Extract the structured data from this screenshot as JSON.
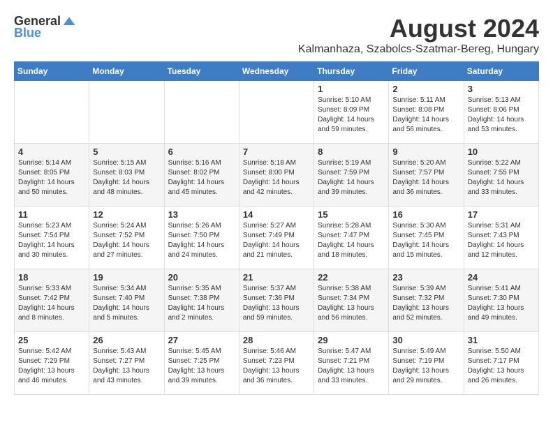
{
  "logo": {
    "general": "General",
    "blue": "Blue"
  },
  "title": "August 2024",
  "location": "Kalmanhaza, Szabolcs-Szatmar-Bereg, Hungary",
  "days_of_week": [
    "Sunday",
    "Monday",
    "Tuesday",
    "Wednesday",
    "Thursday",
    "Friday",
    "Saturday"
  ],
  "weeks": [
    [
      {
        "day": "",
        "info": ""
      },
      {
        "day": "",
        "info": ""
      },
      {
        "day": "",
        "info": ""
      },
      {
        "day": "",
        "info": ""
      },
      {
        "day": "1",
        "info": "Sunrise: 5:10 AM\nSunset: 8:09 PM\nDaylight: 14 hours and 59 minutes."
      },
      {
        "day": "2",
        "info": "Sunrise: 5:11 AM\nSunset: 8:08 PM\nDaylight: 14 hours and 56 minutes."
      },
      {
        "day": "3",
        "info": "Sunrise: 5:13 AM\nSunset: 8:06 PM\nDaylight: 14 hours and 53 minutes."
      }
    ],
    [
      {
        "day": "4",
        "info": "Sunrise: 5:14 AM\nSunset: 8:05 PM\nDaylight: 14 hours and 50 minutes."
      },
      {
        "day": "5",
        "info": "Sunrise: 5:15 AM\nSunset: 8:03 PM\nDaylight: 14 hours and 48 minutes."
      },
      {
        "day": "6",
        "info": "Sunrise: 5:16 AM\nSunset: 8:02 PM\nDaylight: 14 hours and 45 minutes."
      },
      {
        "day": "7",
        "info": "Sunrise: 5:18 AM\nSunset: 8:00 PM\nDaylight: 14 hours and 42 minutes."
      },
      {
        "day": "8",
        "info": "Sunrise: 5:19 AM\nSunset: 7:59 PM\nDaylight: 14 hours and 39 minutes."
      },
      {
        "day": "9",
        "info": "Sunrise: 5:20 AM\nSunset: 7:57 PM\nDaylight: 14 hours and 36 minutes."
      },
      {
        "day": "10",
        "info": "Sunrise: 5:22 AM\nSunset: 7:55 PM\nDaylight: 14 hours and 33 minutes."
      }
    ],
    [
      {
        "day": "11",
        "info": "Sunrise: 5:23 AM\nSunset: 7:54 PM\nDaylight: 14 hours and 30 minutes."
      },
      {
        "day": "12",
        "info": "Sunrise: 5:24 AM\nSunset: 7:52 PM\nDaylight: 14 hours and 27 minutes."
      },
      {
        "day": "13",
        "info": "Sunrise: 5:26 AM\nSunset: 7:50 PM\nDaylight: 14 hours and 24 minutes."
      },
      {
        "day": "14",
        "info": "Sunrise: 5:27 AM\nSunset: 7:49 PM\nDaylight: 14 hours and 21 minutes."
      },
      {
        "day": "15",
        "info": "Sunrise: 5:28 AM\nSunset: 7:47 PM\nDaylight: 14 hours and 18 minutes."
      },
      {
        "day": "16",
        "info": "Sunrise: 5:30 AM\nSunset: 7:45 PM\nDaylight: 14 hours and 15 minutes."
      },
      {
        "day": "17",
        "info": "Sunrise: 5:31 AM\nSunset: 7:43 PM\nDaylight: 14 hours and 12 minutes."
      }
    ],
    [
      {
        "day": "18",
        "info": "Sunrise: 5:33 AM\nSunset: 7:42 PM\nDaylight: 14 hours and 8 minutes."
      },
      {
        "day": "19",
        "info": "Sunrise: 5:34 AM\nSunset: 7:40 PM\nDaylight: 14 hours and 5 minutes."
      },
      {
        "day": "20",
        "info": "Sunrise: 5:35 AM\nSunset: 7:38 PM\nDaylight: 14 hours and 2 minutes."
      },
      {
        "day": "21",
        "info": "Sunrise: 5:37 AM\nSunset: 7:36 PM\nDaylight: 13 hours and 59 minutes."
      },
      {
        "day": "22",
        "info": "Sunrise: 5:38 AM\nSunset: 7:34 PM\nDaylight: 13 hours and 56 minutes."
      },
      {
        "day": "23",
        "info": "Sunrise: 5:39 AM\nSunset: 7:32 PM\nDaylight: 13 hours and 52 minutes."
      },
      {
        "day": "24",
        "info": "Sunrise: 5:41 AM\nSunset: 7:30 PM\nDaylight: 13 hours and 49 minutes."
      }
    ],
    [
      {
        "day": "25",
        "info": "Sunrise: 5:42 AM\nSunset: 7:29 PM\nDaylight: 13 hours and 46 minutes."
      },
      {
        "day": "26",
        "info": "Sunrise: 5:43 AM\nSunset: 7:27 PM\nDaylight: 13 hours and 43 minutes."
      },
      {
        "day": "27",
        "info": "Sunrise: 5:45 AM\nSunset: 7:25 PM\nDaylight: 13 hours and 39 minutes."
      },
      {
        "day": "28",
        "info": "Sunrise: 5:46 AM\nSunset: 7:23 PM\nDaylight: 13 hours and 36 minutes."
      },
      {
        "day": "29",
        "info": "Sunrise: 5:47 AM\nSunset: 7:21 PM\nDaylight: 13 hours and 33 minutes."
      },
      {
        "day": "30",
        "info": "Sunrise: 5:49 AM\nSunset: 7:19 PM\nDaylight: 13 hours and 29 minutes."
      },
      {
        "day": "31",
        "info": "Sunrise: 5:50 AM\nSunset: 7:17 PM\nDaylight: 13 hours and 26 minutes."
      }
    ]
  ]
}
